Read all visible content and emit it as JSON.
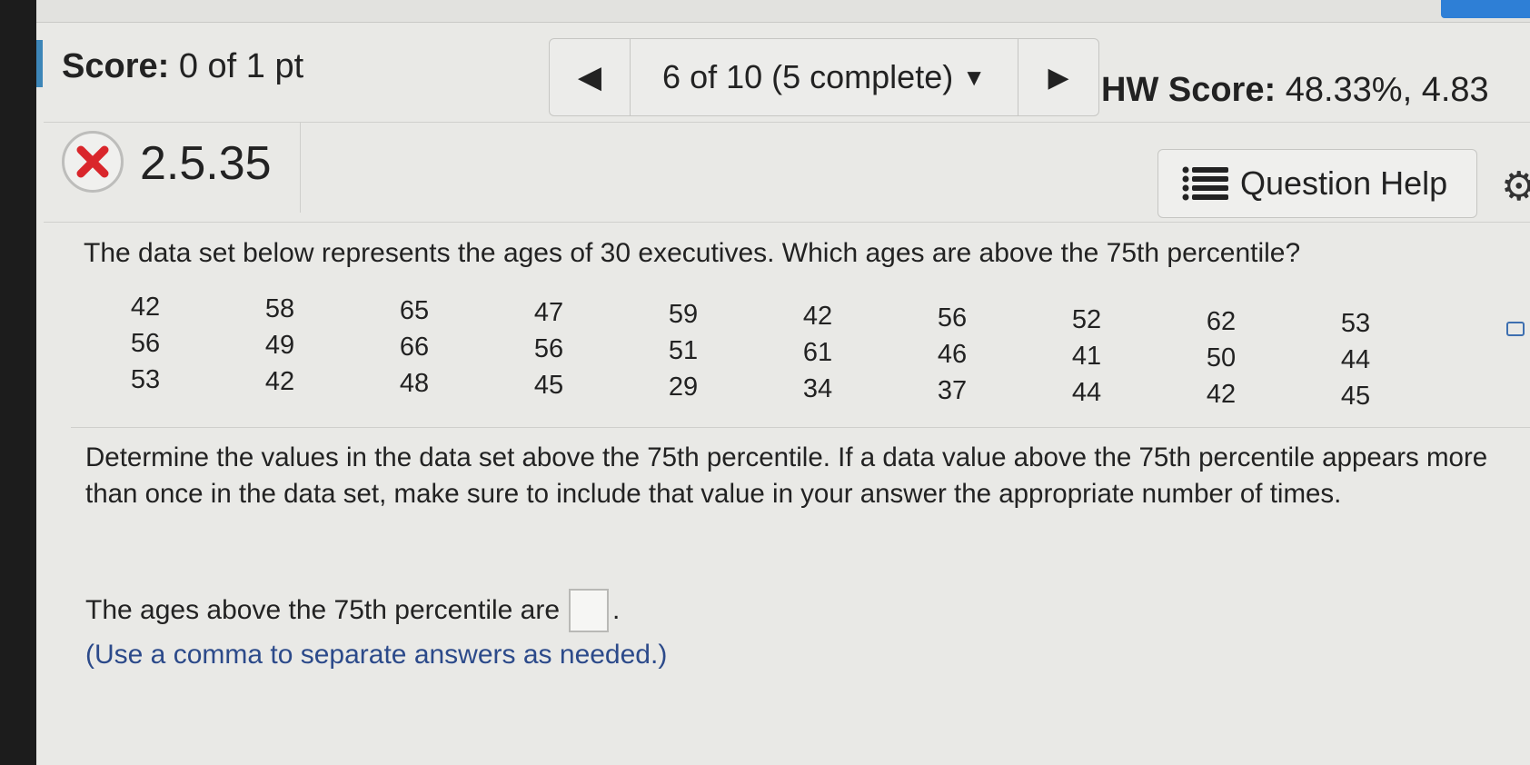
{
  "header": {
    "score_label": "Score:",
    "score_value": "0 of 1 pt",
    "nav_progress": "6 of 10 (5 complete)",
    "hw_score_label": "HW Score:",
    "hw_score_value": "48.33%, 4.83"
  },
  "question": {
    "id": "2.5.35",
    "status_icon": "x-circle-icon",
    "help_label": "Question Help",
    "prompt": "The data set below represents the ages of 30 executives. Which ages are above the 75th percentile?",
    "data_columns": [
      [
        "42",
        "56",
        "53"
      ],
      [
        "58",
        "49",
        "42"
      ],
      [
        "65",
        "66",
        "48"
      ],
      [
        "47",
        "56",
        "45"
      ],
      [
        "59",
        "51",
        "29"
      ],
      [
        "42",
        "61",
        "34"
      ],
      [
        "56",
        "46",
        "37"
      ],
      [
        "52",
        "41",
        "44"
      ],
      [
        "62",
        "50",
        "42"
      ],
      [
        "53",
        "44",
        "45"
      ]
    ],
    "instructions": "Determine the values in the data set above the 75th percentile. If a data value above the 75th percentile appears more than once in the data set, make sure to include that value in your answer the appropriate number of times.",
    "answer_prefix": "The ages above the 75th percentile are",
    "answer_suffix": ".",
    "answer_value": "",
    "hint": "(Use a comma to separate answers as needed.)"
  },
  "colors": {
    "accent_blue": "#2e7fd6",
    "error_red": "#d9262b",
    "hint_blue": "#2c4a8a"
  }
}
